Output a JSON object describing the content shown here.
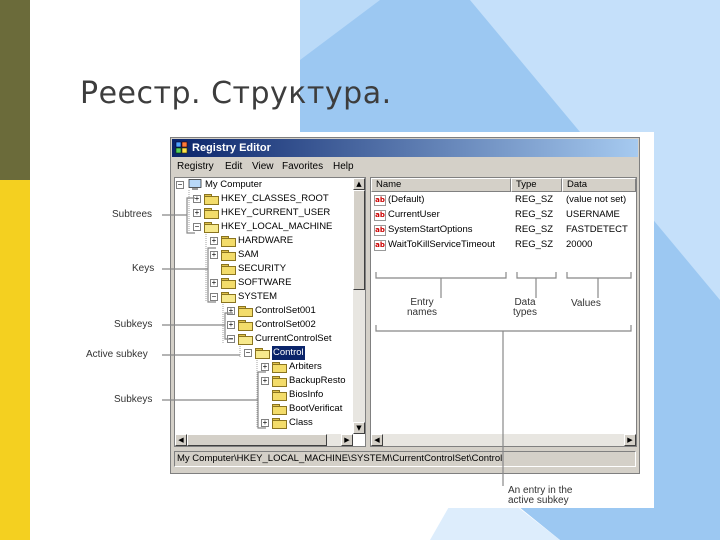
{
  "slide": {
    "title": "Реестр. Структура.",
    "colors": {
      "olive": "#6b6b3a",
      "yellow": "#f4d020",
      "sky": "#9cc8f2",
      "sky_light": "#cfe6fb"
    }
  },
  "window": {
    "title": "Registry Editor",
    "menu": [
      "Registry",
      "Edit",
      "View",
      "Favorites",
      "Help"
    ],
    "tree": [
      {
        "label": "My Computer",
        "toggle": "−",
        "icon": "computer-icon"
      },
      {
        "label": "HKEY_CLASSES_ROOT",
        "toggle": "+",
        "icon": "folder-icon"
      },
      {
        "label": "HKEY_CURRENT_USER",
        "toggle": "+",
        "icon": "folder-icon"
      },
      {
        "label": "HKEY_LOCAL_MACHINE",
        "toggle": "−",
        "icon": "folder-icon"
      },
      {
        "label": "HARDWARE",
        "toggle": "+",
        "icon": "folder-icon"
      },
      {
        "label": "SAM",
        "toggle": "+",
        "icon": "folder-icon"
      },
      {
        "label": "SECURITY",
        "toggle": "",
        "icon": "folder-icon"
      },
      {
        "label": "SOFTWARE",
        "toggle": "+",
        "icon": "folder-icon"
      },
      {
        "label": "SYSTEM",
        "toggle": "−",
        "icon": "folder-icon"
      },
      {
        "label": "ControlSet001",
        "toggle": "+",
        "icon": "folder-icon"
      },
      {
        "label": "ControlSet002",
        "toggle": "+",
        "icon": "folder-icon"
      },
      {
        "label": "CurrentControlSet",
        "toggle": "−",
        "icon": "folder-icon"
      },
      {
        "label": "Control",
        "toggle": "−",
        "icon": "open-folder-icon"
      },
      {
        "label": "Arbiters",
        "toggle": "+",
        "icon": "folder-icon"
      },
      {
        "label": "BackupResto",
        "toggle": "+",
        "icon": "folder-icon"
      },
      {
        "label": "BiosInfo",
        "toggle": "",
        "icon": "folder-icon"
      },
      {
        "label": "BootVerificat",
        "toggle": "",
        "icon": "folder-icon"
      },
      {
        "label": "Class",
        "toggle": "+",
        "icon": "folder-icon"
      }
    ],
    "columns": [
      "Name",
      "Type",
      "Data"
    ],
    "values": [
      {
        "name": "(Default)",
        "type": "REG_SZ",
        "data": "(value not set)"
      },
      {
        "name": "CurrentUser",
        "type": "REG_SZ",
        "data": "USERNAME"
      },
      {
        "name": "SystemStartOptions",
        "type": "REG_SZ",
        "data": "FASTDETECT"
      },
      {
        "name": "WaitToKillServiceTimeout",
        "type": "REG_SZ",
        "data": "20000"
      }
    ],
    "value_icon_text": "ab",
    "status_path": "My Computer\\HKEY_LOCAL_MACHINE\\SYSTEM\\CurrentControlSet\\Control"
  },
  "annotations": {
    "subtrees": "Subtrees",
    "keys": "Keys",
    "subkeys_1": "Subkeys",
    "active_subkey": "Active subkey",
    "subkeys_2": "Subkeys",
    "entry_names_1": "Entry",
    "entry_names_2": "names",
    "data_types_1": "Data",
    "data_types_2": "types",
    "values": "Values",
    "active_entry_1": "An entry in the",
    "active_entry_2": "active subkey"
  }
}
